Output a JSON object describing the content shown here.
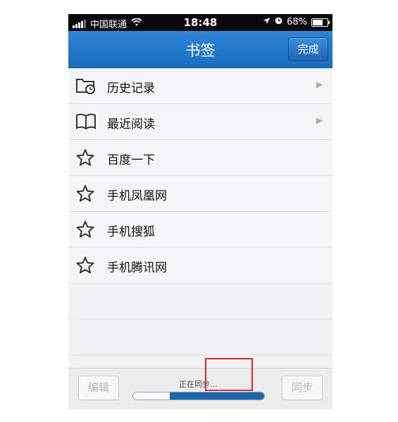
{
  "status_bar": {
    "carrier": "中国联通",
    "time": "18:48",
    "battery_percent": "68%",
    "battery_level": 0.68
  },
  "nav": {
    "title": "书签",
    "done_label": "完成"
  },
  "list": {
    "items": [
      {
        "label": "历史记录",
        "icon": "history-folder-icon",
        "chevron": true
      },
      {
        "label": "最近阅读",
        "icon": "book-icon",
        "chevron": true
      },
      {
        "label": "百度一下",
        "icon": "star-icon",
        "chevron": false
      },
      {
        "label": "手机凤凰网",
        "icon": "star-icon",
        "chevron": false
      },
      {
        "label": "手机搜狐",
        "icon": "star-icon",
        "chevron": false
      },
      {
        "label": "手机腾讯网",
        "icon": "star-icon",
        "chevron": false
      }
    ]
  },
  "toolbar": {
    "edit_label": "编辑",
    "sync_status": "正在同步...",
    "sync_label": "同步",
    "progress": 0.28
  },
  "colors": {
    "nav_blue": "#1a6cc0",
    "highlight_red": "#e2252b",
    "progress_blue": "#1b66b3"
  }
}
